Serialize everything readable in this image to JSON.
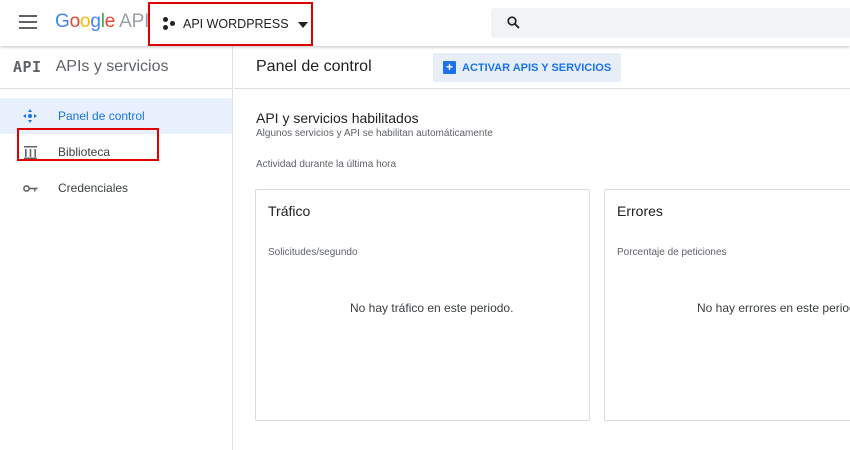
{
  "topbar": {
    "brand_letters": [
      "G",
      "o",
      "o",
      "g",
      "l",
      "e"
    ],
    "brand_suffix": " APIs",
    "project_name": "API WORDPRESS",
    "search_placeholder": ""
  },
  "sidebar": {
    "api_badge": "API",
    "title": "APIs y servicios",
    "items": [
      {
        "label": "Panel de control",
        "icon": "dashboard-icon",
        "active": true
      },
      {
        "label": "Biblioteca",
        "icon": "library-icon",
        "active": false
      },
      {
        "label": "Credenciales",
        "icon": "key-icon",
        "active": false
      }
    ]
  },
  "main": {
    "title": "Panel de control",
    "enable_button": "ACTIVAR APIS Y SERVICIOS",
    "section_title": "API y servicios habilitados",
    "section_subtitle": "Algunos servicios y API se habilitan automáticamente",
    "activity_label": "Actividad durante la última hora",
    "cards": [
      {
        "title": "Tráfico",
        "subtitle": "Solicitudes/segundo",
        "message": "No hay tráfico en este periodo."
      },
      {
        "title": "Errores",
        "subtitle": "Porcentaje de peticiones",
        "message": "No hay errores en este periodo."
      }
    ]
  },
  "colors": {
    "accent": "#1a73e8",
    "highlight_box": "#e00000",
    "active_nav_bg": "#e8f0fe"
  }
}
